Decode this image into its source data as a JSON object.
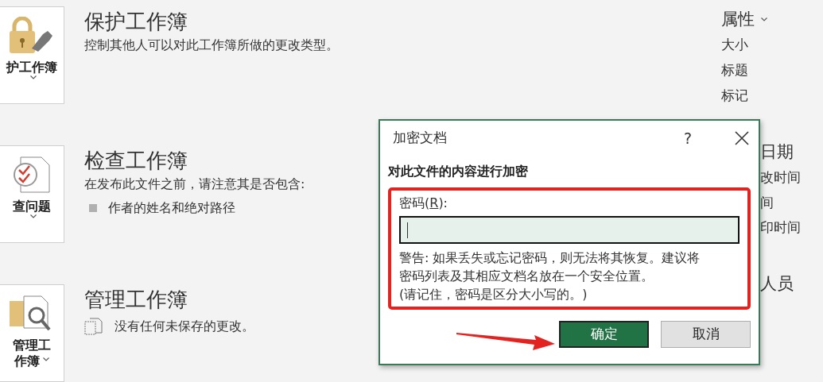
{
  "sections": [
    {
      "button": {
        "lines": [
          "护工作簿"
        ],
        "caret_inline": false
      },
      "title": "保护工作簿",
      "description": "控制其他人可以对此工作簿所做的更改类型。"
    },
    {
      "button": {
        "lines": [
          "查问题"
        ],
        "caret_inline": false
      },
      "title": "检查工作簿",
      "description": "在发布此文件之前，请注意其是否包含:",
      "items": [
        {
          "kind": "bullet",
          "text": "作者的姓名和绝对路径"
        }
      ]
    },
    {
      "button": {
        "lines": [
          "管理工",
          "作簿"
        ],
        "caret_inline": true
      },
      "title": "管理工作簿",
      "items": [
        {
          "kind": "status",
          "text": "没有任何未保存的更改。"
        }
      ]
    }
  ],
  "properties": [
    {
      "kind": "heading",
      "text": "属性",
      "caret": true,
      "covered": false
    },
    {
      "kind": "item",
      "text": "大小",
      "covered": false
    },
    {
      "kind": "item",
      "text": "标题",
      "covered": false
    },
    {
      "kind": "item",
      "text": "标记",
      "covered": false
    },
    {
      "kind": "heading",
      "text": "日期",
      "caret": false,
      "covered": true
    },
    {
      "kind": "item",
      "text": "改时间",
      "covered": true
    },
    {
      "kind": "item",
      "text": "间",
      "covered": true
    },
    {
      "kind": "item",
      "text": "印时间",
      "covered": true
    },
    {
      "kind": "heading",
      "text": "人员",
      "caret": false,
      "covered": true
    }
  ],
  "dialog": {
    "title": "加密文档",
    "help": "?",
    "heading": "对此文件的内容进行加密",
    "password": {
      "label_parts": [
        "密码(",
        "R",
        "):"
      ],
      "focused": true
    },
    "warning": [
      "警告: 如果丢失或忘记密码，则无法将其恢复。建议将",
      "密码列表及其相应文档名放在一个安全位置。",
      "(请记住，密码是区分大小写的。)"
    ],
    "buttons": [
      {
        "label": "确定",
        "default": true
      },
      {
        "label": "取消",
        "default": false
      }
    ]
  }
}
